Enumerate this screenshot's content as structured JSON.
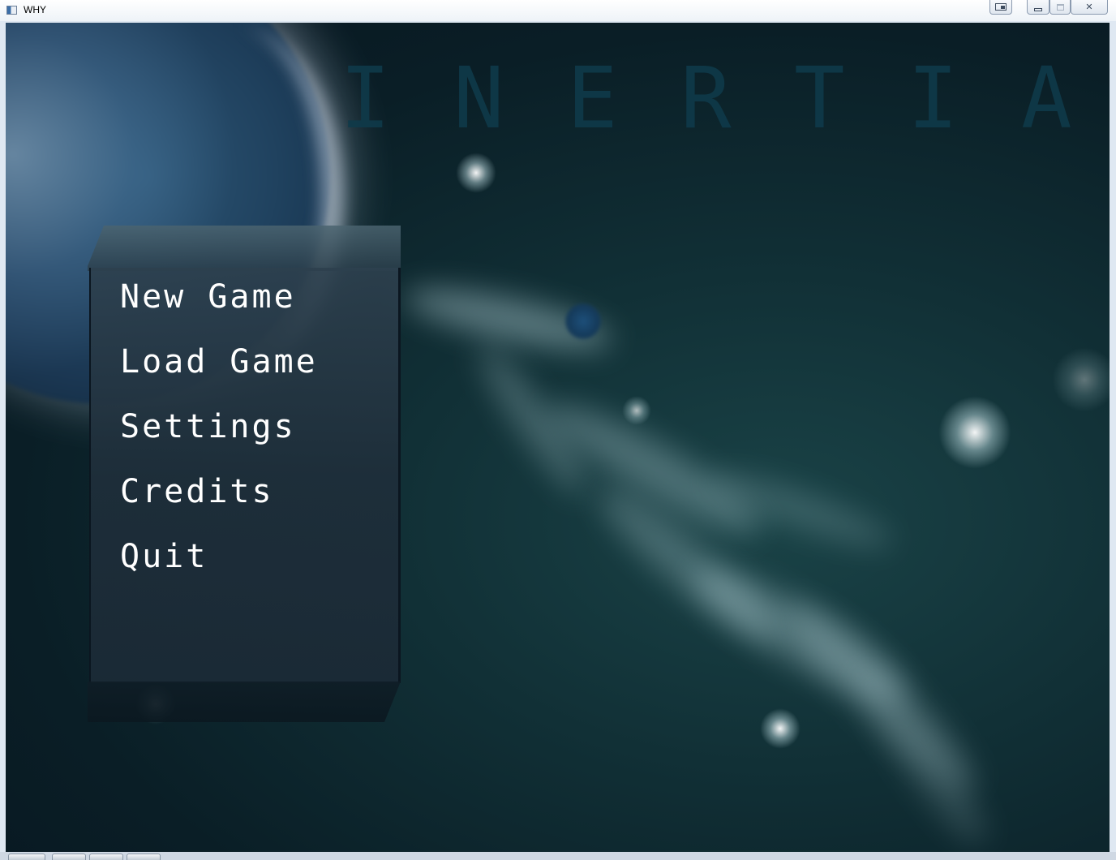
{
  "window": {
    "title": "WHY"
  },
  "game": {
    "title_letters": [
      "I",
      "N",
      "E",
      "R",
      "T",
      "I",
      "A"
    ],
    "menu": [
      {
        "id": "new-game",
        "label": "New Game"
      },
      {
        "id": "load-game",
        "label": "Load Game"
      },
      {
        "id": "settings",
        "label": "Settings"
      },
      {
        "id": "credits",
        "label": "Credits"
      },
      {
        "id": "quit",
        "label": "Quit"
      }
    ]
  },
  "colors": {
    "title_text": "#0f3a4a",
    "menu_text": "#ffffff",
    "background": "#0a1e26"
  },
  "icons": {
    "app": "app-window-icon",
    "extra": "restore-aero-icon",
    "minimize": "minimize-icon",
    "maximize": "maximize-icon",
    "close": "close-icon"
  }
}
